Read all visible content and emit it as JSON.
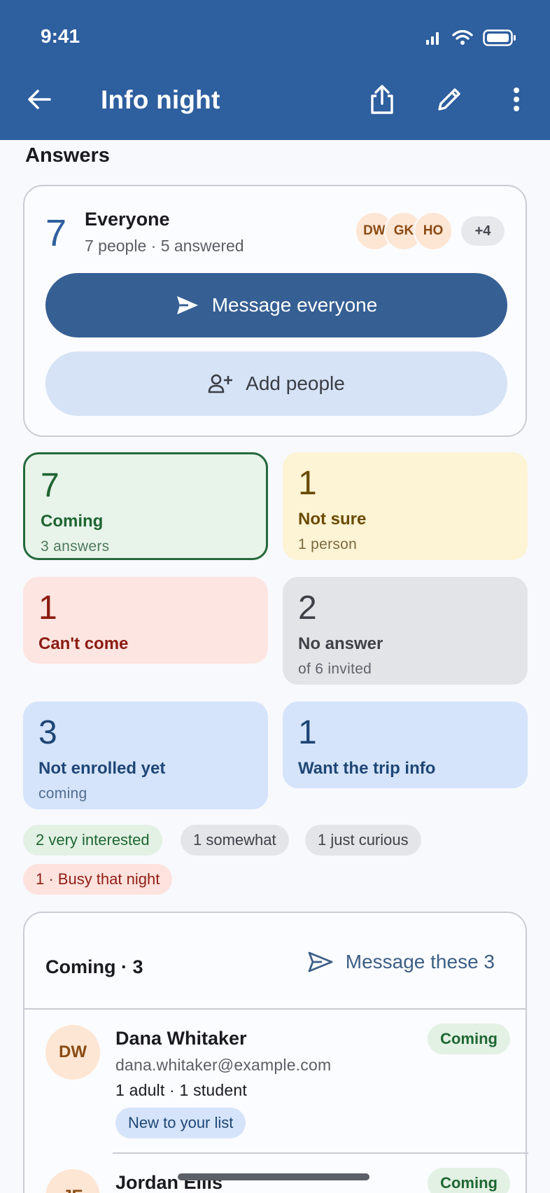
{
  "status_bar": {
    "time": "9:41"
  },
  "app_bar": {
    "title": "Info night",
    "icons": [
      "back-arrow-icon",
      "share-icon",
      "edit-pencil-icon",
      "more-vert-icon"
    ]
  },
  "section_title": "Answers",
  "everyone": {
    "count": "7",
    "title": "Everyone",
    "subtitle": "7 people · 5 answered",
    "avatars": [
      "DW",
      "GK",
      "HO"
    ],
    "more": "+4",
    "message_button": "Message everyone",
    "add_button": "Add people"
  },
  "tiles": {
    "coming": {
      "num": "7",
      "label": "Coming",
      "sub": "3 answers"
    },
    "not_sure": {
      "num": "1",
      "label": "Not sure",
      "sub": "1 person"
    },
    "cant_come": {
      "num": "1",
      "label": "Can't come"
    },
    "no_answer": {
      "num": "2",
      "label": "No answer",
      "sub": "of 6 invited"
    },
    "not_enrolled": {
      "num": "3",
      "label": "Not enrolled yet",
      "sub": "coming"
    },
    "trip_info": {
      "num": "1",
      "label": "Want the trip info"
    }
  },
  "chips": {
    "very_interested": "2 very interested",
    "somewhat": "1 somewhat",
    "just_curious": "1 just curious",
    "busy": "1 · Busy that night"
  },
  "coming_list": {
    "header": "Coming · 3",
    "action": "Message these 3",
    "rows": [
      {
        "initials": "DW",
        "name": "Dana Whitaker",
        "email": "dana.whitaker@example.com",
        "detail": "1 adult · 1 student",
        "tag": "New to your list",
        "status": "Coming"
      },
      {
        "initials": "JE",
        "name": "Jordan Ellis",
        "status": "Coming"
      }
    ]
  },
  "colors": {
    "primary": "#2e5f9e",
    "coming": "#24693b",
    "not_sure": "#6a4b00",
    "cant_come": "#8a1c12"
  }
}
